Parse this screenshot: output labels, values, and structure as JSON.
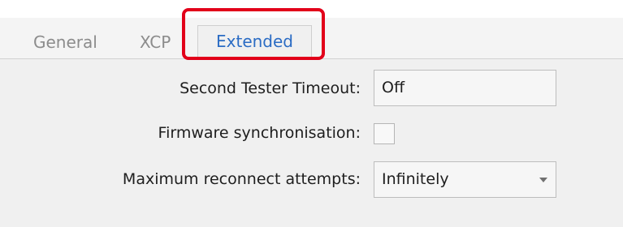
{
  "tabs": [
    {
      "label": "General",
      "active": false
    },
    {
      "label": "XCP",
      "active": false
    },
    {
      "label": "Extended",
      "active": true
    }
  ],
  "fields": {
    "second_tester_timeout": {
      "label": "Second Tester Timeout:",
      "value": "Off"
    },
    "firmware_sync": {
      "label": "Firmware synchronisation:",
      "checked": false
    },
    "max_reconnect": {
      "label": "Maximum reconnect attempts:",
      "value": "Infinitely"
    }
  },
  "colors": {
    "active_tab_text": "#2b6cc4",
    "highlight": "#e2001a",
    "background": "#f0f0f0"
  },
  "icons": {
    "dropdown": "chevron-down-icon"
  }
}
